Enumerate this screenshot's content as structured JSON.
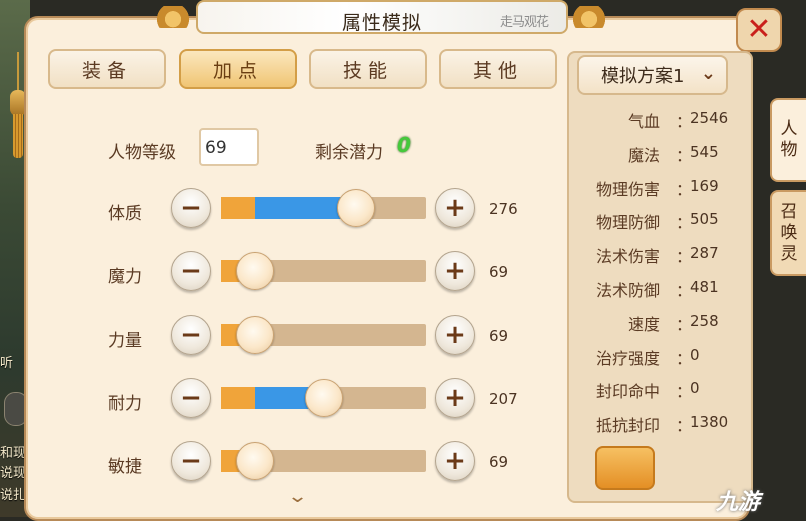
{
  "window": {
    "title": "属性模拟",
    "title_deco": "走马观花"
  },
  "tabs": [
    {
      "label": "装备",
      "active": false
    },
    {
      "label": "加点",
      "active": true
    },
    {
      "label": "技能",
      "active": false
    },
    {
      "label": "其他",
      "active": false
    }
  ],
  "form": {
    "level_label": "人物等级",
    "level_value": "69",
    "potential_label": "剩余潜力",
    "potential_value": "0",
    "attributes": [
      {
        "label": "体质",
        "value": "276",
        "fill_fraction": 0.66
      },
      {
        "label": "魔力",
        "value": "69",
        "fill_fraction": 0.16
      },
      {
        "label": "力量",
        "value": "69",
        "fill_fraction": 0.16
      },
      {
        "label": "耐力",
        "value": "207",
        "fill_fraction": 0.5
      },
      {
        "label": "敏捷",
        "value": "69",
        "fill_fraction": 0.16
      }
    ],
    "minus_glyph": "−",
    "plus_glyph": "+",
    "scroll_glyph": "⌄"
  },
  "plan": {
    "selected": "模拟方案1",
    "chevron": "⌄"
  },
  "stats": [
    {
      "name": "气血",
      "value": "2546"
    },
    {
      "name": "魔法",
      "value": "545"
    },
    {
      "name": "物理伤害",
      "value": "169"
    },
    {
      "name": "物理防御",
      "value": "505"
    },
    {
      "name": "法术伤害",
      "value": "287"
    },
    {
      "name": "法术防御",
      "value": "481"
    },
    {
      "name": "速度",
      "value": "258"
    },
    {
      "name": "治疗强度",
      "value": "0"
    },
    {
      "name": "封印命中",
      "value": "0"
    },
    {
      "name": "抵抗封印",
      "value": "1380"
    }
  ],
  "stat_colon": "：",
  "side_tabs": [
    {
      "label": "人物",
      "active": true
    },
    {
      "label": "召唤灵",
      "active": false
    }
  ],
  "close_glyph": "✕",
  "background_chat": [
    "和现",
    "说现",
    "说扎",
    "听"
  ],
  "watermark": "九游",
  "colors": {
    "accent_blue": "#3a97e6",
    "accent_orange": "#f0a43a",
    "potential_green": "#45c93b",
    "close_red": "#c9201b"
  }
}
